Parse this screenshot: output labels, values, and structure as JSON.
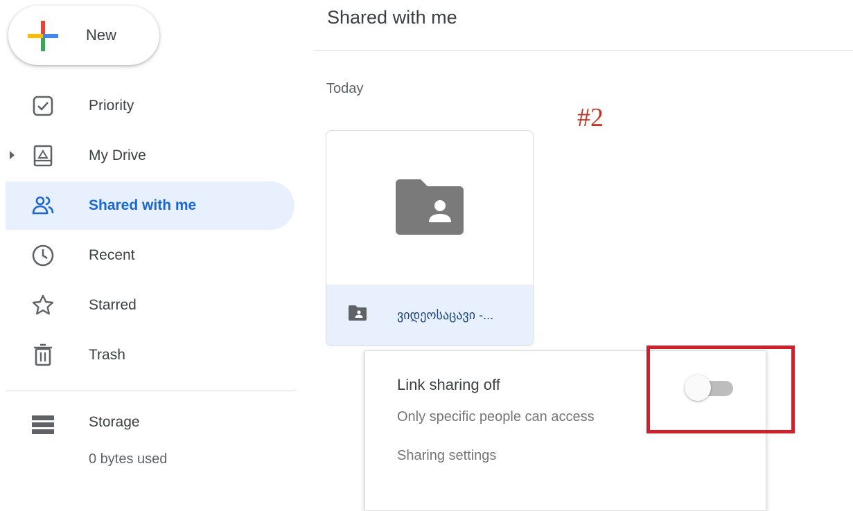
{
  "new_button": {
    "label": "New"
  },
  "sidebar": {
    "items": [
      {
        "label": "Priority",
        "icon": "checkbox-icon",
        "active": false
      },
      {
        "label": "My Drive",
        "icon": "drive-icon",
        "active": false
      },
      {
        "label": "Shared with me",
        "icon": "people-icon",
        "active": true
      },
      {
        "label": "Recent",
        "icon": "clock-icon",
        "active": false
      },
      {
        "label": "Starred",
        "icon": "star-icon",
        "active": false
      },
      {
        "label": "Trash",
        "icon": "trash-icon",
        "active": false
      }
    ],
    "storage": {
      "label": "Storage",
      "used": "0 bytes used"
    }
  },
  "main": {
    "title": "Shared with me",
    "section": "Today",
    "annotation": "#2",
    "card": {
      "name": "ვიდეოსაცავი -..."
    }
  },
  "popup": {
    "title": "Link sharing off",
    "subtitle": "Only specific people can access",
    "settings_link": "Sharing settings",
    "toggle_on": false
  },
  "colors": {
    "active_bg": "#e8f0fe",
    "active_text": "#1967d2",
    "highlight": "#d0202b",
    "annotation": "#c0392b"
  }
}
